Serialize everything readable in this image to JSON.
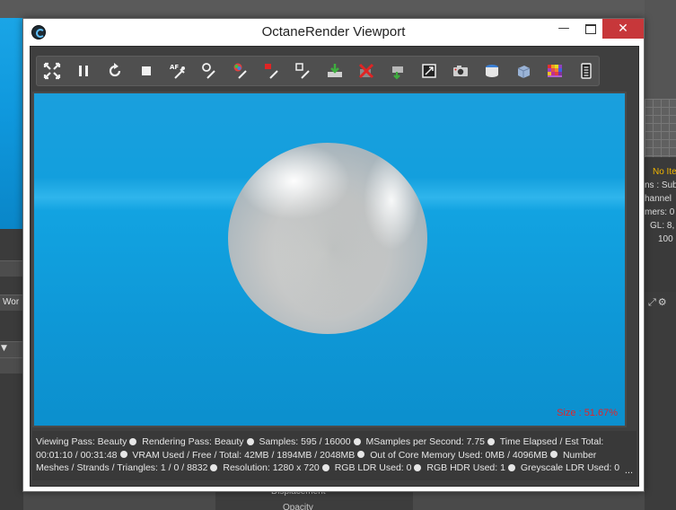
{
  "window": {
    "title": "OctaneRender Viewport",
    "minimize_glyph": "—",
    "close_glyph": "✕"
  },
  "toolbar": {
    "tools": [
      {
        "name": "recenter-view-icon",
        "tooltip": ""
      },
      {
        "name": "pause-icon",
        "tooltip": ""
      },
      {
        "name": "restart-icon",
        "tooltip": ""
      },
      {
        "name": "stop-icon",
        "tooltip": ""
      },
      {
        "name": "autofocus-picker-icon",
        "label": "AF"
      },
      {
        "name": "zoom-picker-icon",
        "tooltip": ""
      },
      {
        "name": "white-balance-picker-icon",
        "tooltip": ""
      },
      {
        "name": "material-picker-icon",
        "tooltip": ""
      },
      {
        "name": "object-picker-icon",
        "tooltip": ""
      },
      {
        "name": "import-icon",
        "tooltip": ""
      },
      {
        "name": "disable-icon",
        "tooltip": ""
      },
      {
        "name": "camera-target-icon",
        "tooltip": ""
      },
      {
        "name": "region-render-icon",
        "tooltip": ""
      },
      {
        "name": "camera-icon",
        "tooltip": ""
      },
      {
        "name": "save-image-icon",
        "tooltip": ""
      },
      {
        "name": "cube-icon",
        "tooltip": ""
      },
      {
        "name": "color-grid-icon",
        "tooltip": ""
      },
      {
        "name": "settings-panel-icon",
        "tooltip": ""
      }
    ],
    "colors": {
      "accent_green": "#3fae3f",
      "accent_red": "#e02424",
      "accent_blue": "#3a7fd6"
    }
  },
  "viewport": {
    "size_label": "Size : 51.67%",
    "size_color": "#e0252a",
    "background_color": "#14a2df"
  },
  "status": {
    "line1": [
      "Viewing Pass: Beauty",
      "Rendering Pass: Beauty",
      "Samples: 595  / 16000",
      "MSamples per Second: 7.75",
      "Time Elapsed / Est Total:"
    ],
    "line2": [
      "00:01:10 / 00:31:48",
      "VRAM Used / Free / Total: 42MB / 1894MB / 2048MB",
      "Out of Core Memory Used: 0MB / 4096MB",
      "Number"
    ],
    "line3": [
      "Meshes / Strands / Triangles: 1 / 0 / 8832",
      "Resolution: 1280 x 720",
      "RGB LDR Used: 0",
      "RGB HDR Used: 1",
      "Greyscale LDR Used: 0"
    ],
    "more": "..."
  },
  "background": {
    "left_label": "Wor",
    "left_arrow": "▼",
    "right_lines": [
      "No Ite",
      "ns : Sub",
      "hannel",
      "mers: 0",
      "GL: 8,",
      "100"
    ],
    "right_tools": "⤢⚙",
    "bottom_labels": [
      "Displacement",
      "Opacity"
    ]
  }
}
